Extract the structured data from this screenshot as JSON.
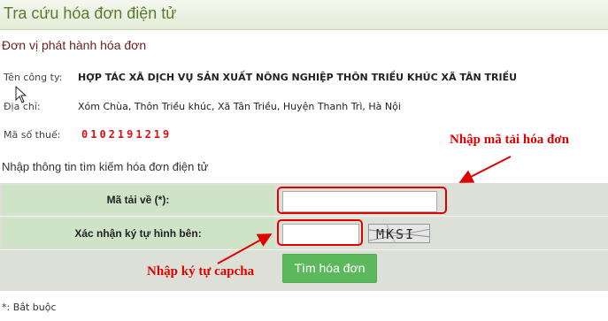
{
  "header": {
    "title": "Tra cứu hóa đơn điện tử"
  },
  "issuer": {
    "heading": "Đơn vị phát hành hóa đơn",
    "company_label": "Tên công ty:",
    "company_value": "HỢP TÁC XÃ DỊCH VỤ SẢN XUẤT NÔNG NGHIỆP THÔN TRIỀU KHÚC XÃ TÂN TRIỀU",
    "address_label": "Địa chỉ:",
    "address_value": "Xóm Chùa, Thôn Triều khúc, Xã Tân Triều, Huyện Thanh Trì, Hà Nội",
    "tax_label": "Mã số thuế:",
    "tax_value": "0102191219"
  },
  "search": {
    "heading": "Nhập thông tin tìm kiếm hóa đơn điện tử",
    "code_label": "Mã tải về (*):",
    "code_value": "",
    "captcha_label": "Xác nhận ký tự hình bên:",
    "captcha_value": "",
    "captcha_image_text": "MKSI",
    "submit_label": "Tìm hóa đơn"
  },
  "annotations": {
    "code_hint": "Nhập mã tải hóa đơn",
    "captcha_hint": "Nhập ký tự capcha"
  },
  "footer": {
    "required_note": "*: Bắt buộc"
  },
  "colors": {
    "accent_green": "#5cb85c",
    "title_green": "#5a7a2e",
    "heading_maroon": "#6b1f1f",
    "annotation_red": "#e00000"
  }
}
